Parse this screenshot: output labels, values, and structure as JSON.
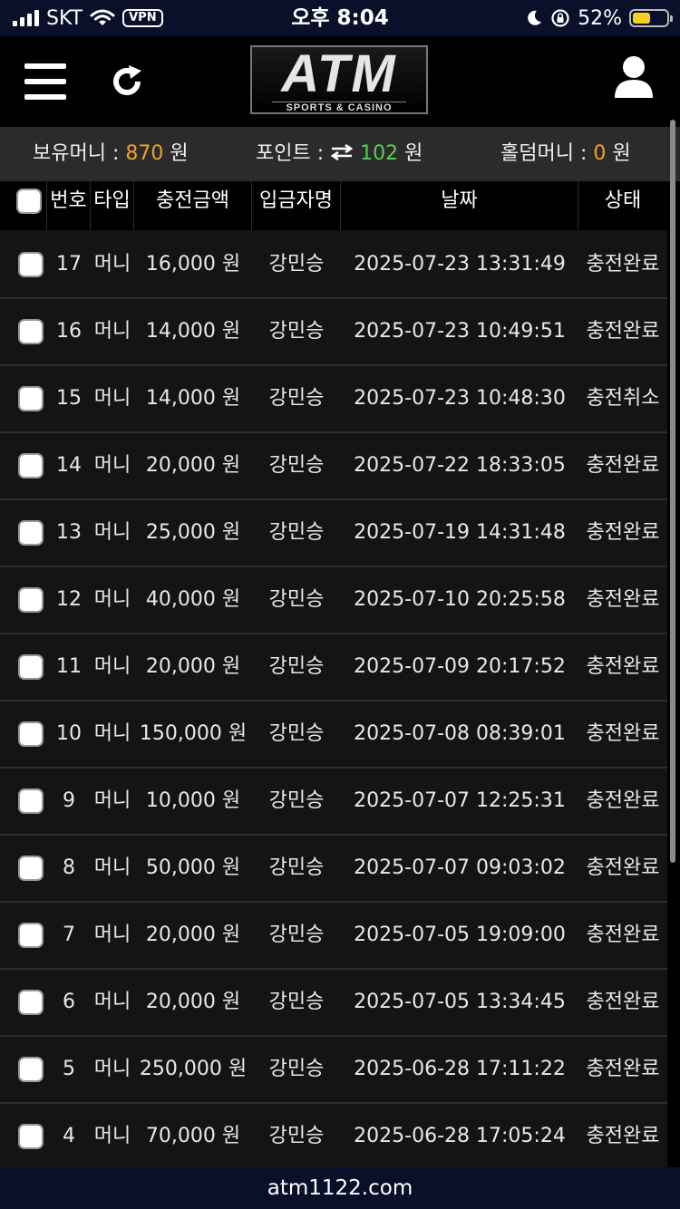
{
  "status": {
    "carrier": "SKT",
    "vpn": "VPN",
    "time": "오후 8:04",
    "battery_text": "52%",
    "battery_level": 0.52,
    "battery_color": "#f5d020"
  },
  "header": {
    "menu_icon": "hamburger-menu-icon",
    "refresh_icon": "refresh-icon",
    "logo_text": "ATM",
    "logo_sub": "SPORTS & CASINO",
    "user_icon": "user-icon"
  },
  "money": {
    "holding_label": "보유머니 : ",
    "holding_value": "870",
    "holding_unit": " 원",
    "point_label": "포인트 : ",
    "point_value": "102",
    "point_unit": " 원",
    "holdem_label": "홀덤머니 : ",
    "holdem_value": "0",
    "holdem_unit": " 원"
  },
  "table": {
    "headers": {
      "no": "번호",
      "type": "타입",
      "amount": "충전금액",
      "depositor": "입금자명",
      "date": "날짜",
      "status": "상태"
    },
    "rows": [
      {
        "no": "17",
        "type": "머니",
        "amount": "16,000 원",
        "depositor": "강민승",
        "date": "2025-07-23 13:31:49",
        "status": "충전완료"
      },
      {
        "no": "16",
        "type": "머니",
        "amount": "14,000 원",
        "depositor": "강민승",
        "date": "2025-07-23 10:49:51",
        "status": "충전완료"
      },
      {
        "no": "15",
        "type": "머니",
        "amount": "14,000 원",
        "depositor": "강민승",
        "date": "2025-07-23 10:48:30",
        "status": "충전취소"
      },
      {
        "no": "14",
        "type": "머니",
        "amount": "20,000 원",
        "depositor": "강민승",
        "date": "2025-07-22 18:33:05",
        "status": "충전완료"
      },
      {
        "no": "13",
        "type": "머니",
        "amount": "25,000 원",
        "depositor": "강민승",
        "date": "2025-07-19 14:31:48",
        "status": "충전완료"
      },
      {
        "no": "12",
        "type": "머니",
        "amount": "40,000 원",
        "depositor": "강민승",
        "date": "2025-07-10 20:25:58",
        "status": "충전완료"
      },
      {
        "no": "11",
        "type": "머니",
        "amount": "20,000 원",
        "depositor": "강민승",
        "date": "2025-07-09 20:17:52",
        "status": "충전완료"
      },
      {
        "no": "10",
        "type": "머니",
        "amount": "150,000 원",
        "depositor": "강민승",
        "date": "2025-07-08 08:39:01",
        "status": "충전완료"
      },
      {
        "no": "9",
        "type": "머니",
        "amount": "10,000 원",
        "depositor": "강민승",
        "date": "2025-07-07 12:25:31",
        "status": "충전완료"
      },
      {
        "no": "8",
        "type": "머니",
        "amount": "50,000 원",
        "depositor": "강민승",
        "date": "2025-07-07 09:03:02",
        "status": "충전완료"
      },
      {
        "no": "7",
        "type": "머니",
        "amount": "20,000 원",
        "depositor": "강민승",
        "date": "2025-07-05 19:09:00",
        "status": "충전완료"
      },
      {
        "no": "6",
        "type": "머니",
        "amount": "20,000 원",
        "depositor": "강민승",
        "date": "2025-07-05 13:34:45",
        "status": "충전완료"
      },
      {
        "no": "5",
        "type": "머니",
        "amount": "250,000 원",
        "depositor": "강민승",
        "date": "2025-06-28 17:11:22",
        "status": "충전완료"
      },
      {
        "no": "4",
        "type": "머니",
        "amount": "70,000 원",
        "depositor": "강민승",
        "date": "2025-06-28 17:05:24",
        "status": "충전완료"
      }
    ]
  },
  "footer": {
    "url": "atm1122.com"
  },
  "colors": {
    "money_accent": "#f0a030",
    "point_accent": "#55d055",
    "status_bar_bg": "#0a0f2a"
  }
}
